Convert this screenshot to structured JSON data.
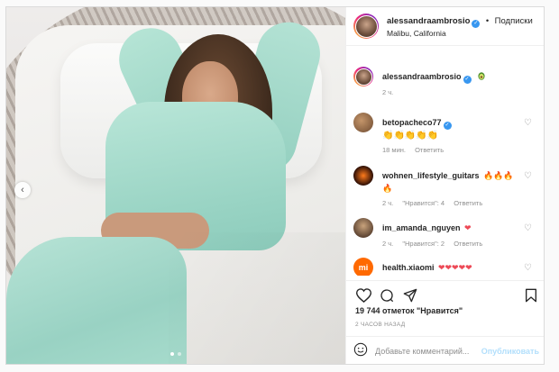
{
  "header": {
    "username": "alessandraambrosio",
    "separator": "•",
    "follow_label": "Подписки",
    "location": "Malibu, California"
  },
  "caption": {
    "username": "alessandraambrosio",
    "emoji": "avocado",
    "time": "2 ч."
  },
  "comments": [
    {
      "username": "betopacheco77",
      "verified": true,
      "text_emoji": "clapping-hands x5",
      "time": "18 мин.",
      "reply": "Ответить",
      "likes": ""
    },
    {
      "username": "wohnen_lifestyle_guitars",
      "verified": false,
      "text_emoji": "fire x4",
      "time": "2 ч.",
      "likes": "\"Нравится\": 4",
      "reply": "Ответить"
    },
    {
      "username": "im_amanda_nguyen",
      "verified": false,
      "text_emoji": "red-heart",
      "time": "2 ч.",
      "likes": "\"Нравится\": 2",
      "reply": "Ответить"
    },
    {
      "username": "health.xiaomi",
      "verified": false,
      "text_emoji": "red-heart x5",
      "time": "",
      "likes": "",
      "reply": ""
    }
  ],
  "likes_text": "19 744 отметок \"Нравится\"",
  "time_ago": "2 ЧАСОВ НАЗАД",
  "comment_input": {
    "placeholder": "Добавьте комментарий...",
    "publish": "Опубликовать"
  },
  "colors": {
    "verified": "#3897f0",
    "heart": "#ed4956",
    "muted": "#8e8e8e",
    "hoodie": "#9ad4c4"
  }
}
